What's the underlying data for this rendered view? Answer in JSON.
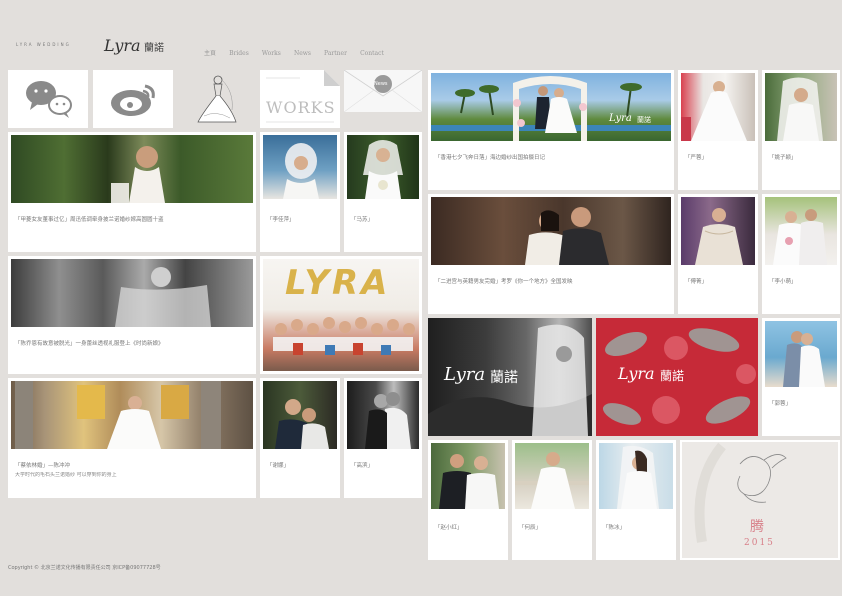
{
  "header": {
    "logo_caps": "LYRA WEDDING",
    "logo_script": "Lyra",
    "logo_cn": "蘭諾",
    "nav": [
      "主頁",
      "Brides",
      "Works",
      "News",
      "Partner",
      "Contact"
    ]
  },
  "tiles": {
    "works_label": "WORKS",
    "news_label": "News"
  },
  "cards": [
    {
      "caption": "「甲菱女友董事过亿」周迅低调牵身披兰诺婚纱嫁高圆圆十盗"
    },
    {
      "caption": "「李佳萍」"
    },
    {
      "caption": "「马苏」"
    },
    {
      "caption": "「陈乔恩有故意被脱光」一身蕾丝透视礼服登上《时尚新娘》"
    },
    {
      "caption": "「蔡依林婚」—陈冲冲",
      "subcaption": "大学时代的毛石头兰诺婚纱 可以穿到你的身上"
    },
    {
      "caption": "「谢娜」"
    },
    {
      "caption": "「高滨」"
    },
    {
      "caption": "「香港七夕飞奔日落」海边婚纱出国拍摄日记"
    },
    {
      "caption": "「严蓉」"
    },
    {
      "caption": "「姚子颖」"
    },
    {
      "caption": "「二进宫与英籍男友完婚」考罗《你一个地方》全国发映"
    },
    {
      "caption": "「傅菁」"
    },
    {
      "caption": "「李小萌」"
    },
    {
      "caption": "「郭蓉」"
    },
    {
      "caption": "「赵小红」"
    },
    {
      "caption": "「何辰」"
    },
    {
      "caption": "「陈冰」"
    }
  ],
  "overlays": {
    "script": "Lyra",
    "cn": "蘭諾",
    "lyra_balloons": "LYRA"
  },
  "promo": {
    "char": "腾",
    "year": "2015"
  },
  "footer": "Copyright © 北京兰诺文化传播有限责任公司 京ICP备09077728号",
  "colors": {
    "background": "#e2dfdc",
    "card": "#ffffff",
    "icon_gray": "#8a8a8a",
    "accent_red": "#c62a38"
  }
}
